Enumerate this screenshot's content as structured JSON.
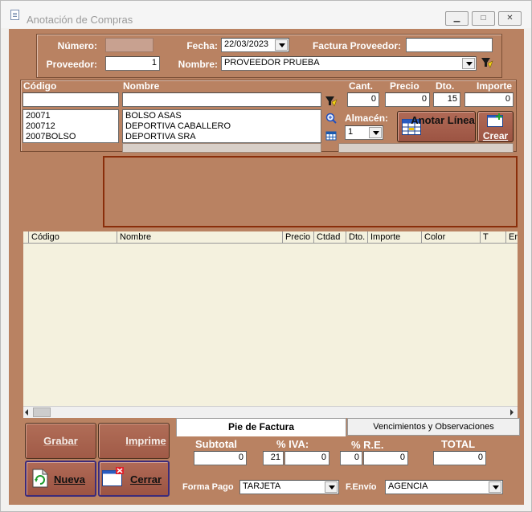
{
  "window": {
    "title": "Anotación de Compras"
  },
  "header": {
    "numero_label": "Número:",
    "numero_value": "",
    "fecha_label": "Fecha:",
    "fecha_value": "22/03/2023",
    "factura_label": "Factura Proveedor:",
    "factura_value": "",
    "proveedor_label": "Proveedor:",
    "proveedor_value": "1",
    "nombre_label": "Nombre:",
    "nombre_value": "PROVEEDOR PRUEBA"
  },
  "entry": {
    "codigo_label": "Código",
    "nombre_label": "Nombre",
    "cant_label": "Cant.",
    "precio_label": "Precio",
    "dto_label": "Dto.",
    "importe_label": "Importe",
    "codigo_value": "",
    "nombre_value": "",
    "cant_value": "0",
    "precio_value": "0",
    "dto_value": "15",
    "importe_value": "0",
    "almacen_label": "Almacén:",
    "almacen_value": "1",
    "codigos": [
      "20071",
      "200712",
      "2007BOLSO"
    ],
    "nombres": [
      "BOLSO ASAS",
      "DEPORTIVA CABALLERO",
      "DEPORTIVA SRA"
    ],
    "anotar_label": "Anotar Línea",
    "crear_label": "Crear"
  },
  "grid": {
    "columns": [
      "Código",
      "Nombre",
      "Precio",
      "Ctdad",
      "Dto.",
      "Importe",
      "Color",
      "T",
      "Er"
    ]
  },
  "actions": {
    "grabar": "Grabar",
    "imprime": "Imprime",
    "nueva": "Nueva",
    "cerrar": "Cerrar"
  },
  "tabs": {
    "pie": "Pie de Factura",
    "venc": "Vencimientos y Observaciones"
  },
  "footer": {
    "subtotal_label": "Subtotal",
    "subtotal_value": "0",
    "iva_label": "% IVA:",
    "iva_pct": "21",
    "iva_value": "0",
    "re_label": "% R.E.",
    "re_pct": "0",
    "re_value": "0",
    "total_label": "TOTAL",
    "total_value": "0",
    "forma_pago_label": "Forma Pago",
    "forma_pago_value": "TARJETA",
    "envio_label": "F.Envío",
    "envio_value": "AGENCIA"
  }
}
